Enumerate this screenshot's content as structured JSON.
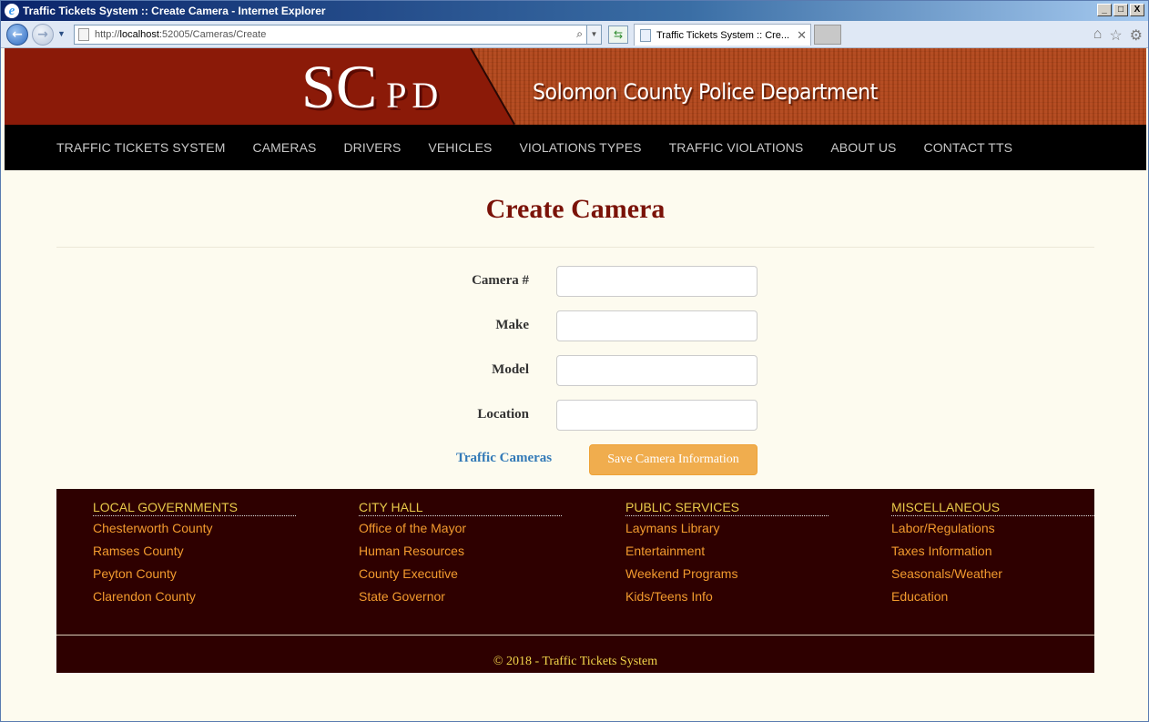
{
  "browser": {
    "window_title": "Traffic Tickets System :: Create Camera - Internet Explorer",
    "url_prefix": "http://",
    "url_host": "localhost",
    "url_rest": ":52005/Cameras/Create",
    "tab_title": "Traffic Tickets System :: Cre...",
    "min_glyph": "_",
    "max_glyph": "□",
    "close_glyph": "X"
  },
  "header": {
    "logo_big": "SC",
    "logo_small": "PD",
    "subtitle": "Solomon County Police Department"
  },
  "nav": {
    "items": [
      "TRAFFIC TICKETS SYSTEM",
      "CAMERAS",
      "DRIVERS",
      "VEHICLES",
      "VIOLATIONS TYPES",
      "TRAFFIC VIOLATIONS",
      "ABOUT US",
      "CONTACT TTS"
    ]
  },
  "main": {
    "title": "Create Camera",
    "fields": [
      {
        "label": "Camera #",
        "value": ""
      },
      {
        "label": "Make",
        "value": ""
      },
      {
        "label": "Model",
        "value": ""
      },
      {
        "label": "Location",
        "value": ""
      }
    ],
    "back_link": "Traffic Cameras",
    "save_button": "Save Camera Information"
  },
  "footer": {
    "columns": [
      {
        "heading": "LOCAL GOVERNMENTS",
        "links": [
          "Chesterworth County",
          "Ramses County",
          "Peyton County",
          "Clarendon County"
        ]
      },
      {
        "heading": "CITY HALL",
        "links": [
          "Office of the Mayor",
          "Human Resources",
          "County Executive",
          "State Governor"
        ]
      },
      {
        "heading": "PUBLIC SERVICES",
        "links": [
          "Laymans Library",
          "Entertainment",
          "Weekend Programs",
          "Kids/Teens Info"
        ]
      },
      {
        "heading": "MISCELLANEOUS",
        "links": [
          "Labor/Regulations",
          "Taxes Information",
          "Seasonals/Weather",
          "Education"
        ]
      }
    ],
    "copyright": "© 2018 - Traffic Tickets System"
  },
  "colors": {
    "banner_dark": "#8b1a08",
    "banner_orange": "#b2461a",
    "heading": "#7a1208",
    "save_button": "#f0ad4e",
    "footer_bg": "#2e0000",
    "footer_heading": "#e8c94a",
    "footer_link": "#f29a2e"
  },
  "icons": [
    "ie-logo-icon",
    "back-arrow-icon",
    "forward-arrow-icon",
    "page-icon",
    "search-icon",
    "refresh-icon",
    "close-tab-icon",
    "home-icon",
    "favorites-star-icon",
    "gear-icon"
  ]
}
